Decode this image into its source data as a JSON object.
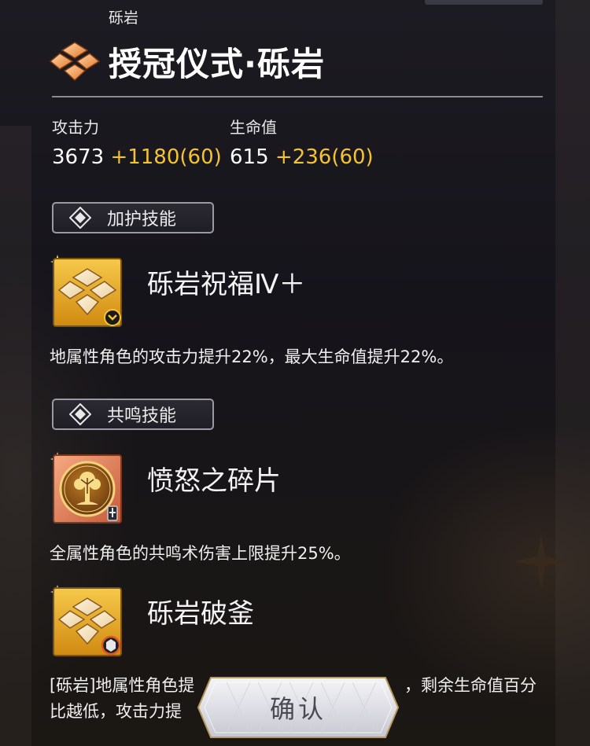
{
  "header": {
    "element_label": "砾岩",
    "title": "授冠仪式·砾岩",
    "title_icon": "geo-emblem-icon"
  },
  "stats": {
    "attack": {
      "label": "攻击力",
      "base": "3673",
      "bonus": "+1180(60)"
    },
    "hp": {
      "label": "生命值",
      "base": "615",
      "bonus": "+236(60)"
    }
  },
  "sections": {
    "protection_label": "加护技能",
    "resonance_label": "共鸣技能"
  },
  "skills": [
    {
      "name": "砾岩祝福Ⅳ＋",
      "icon": "geo-emblem-icon",
      "badge": "chevron-badge-icon",
      "description": "地属性角色的攻击力提升22%，最大生命值提升22%。"
    },
    {
      "name": "愤怒之碎片",
      "icon": "tree-medallion-icon",
      "badge": "sword-badge-icon",
      "description": "全属性角色的共鸣术伤害上限提升25%。"
    },
    {
      "name": "砾岩破釜",
      "icon": "geo-emblem-icon",
      "badge": "crest-badge-icon",
      "description_line1": "[砾岩]地属性角色提",
      "description_line1_tail": "，剩余生命值百分",
      "description_line2": "比越低，攻击力提"
    }
  ],
  "confirm_label": "确认",
  "colors": {
    "bonus": "#f4c430",
    "accent_orange": "#f08a3c",
    "icon_gold": "#e3a21a"
  }
}
